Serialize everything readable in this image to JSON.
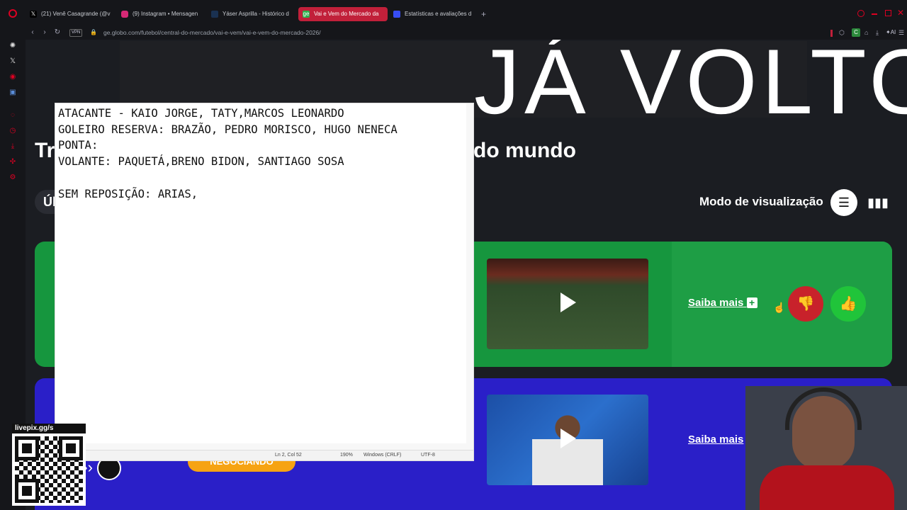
{
  "browser": {
    "tabs": [
      {
        "label": "(21) Venê Casagrande (@v",
        "icon": "x-icon"
      },
      {
        "label": "(9) Instagram • Mensagen",
        "icon": "instagram-icon"
      },
      {
        "label": "Yáser Asprilla - Histórico d",
        "icon": "transfermarkt-icon"
      },
      {
        "label": "Vai e Vem do Mercado da",
        "icon": "ge-icon"
      },
      {
        "label": "Estatísticas e avaliações d",
        "icon": "sofascore-icon"
      }
    ],
    "new_tab": "+",
    "vpn": "VPN",
    "url": "ge.globo.com/futebol/central-do-mercado/vai-e-vem/vai-e-vem-do-mercado-2026/",
    "ai_label": "AI",
    "ext_badge": "C"
  },
  "page": {
    "banner_text": "JÁ VOLTO",
    "heading_left": "Tr",
    "heading_right": "do mundo",
    "tab_left": "Úl",
    "view_mode_label": "Modo de visualização",
    "cards": [
      {
        "saiba_label": "Saiba mais",
        "plus": "+"
      },
      {
        "saiba_label": "Saiba mais"
      }
    ],
    "promo_text": "NEGOCIANDO"
  },
  "notepad": {
    "lines": [
      "ATACANTE - KAIO JORGE, TATY,MARCOS LEONARDO",
      "GOLEIRO RESERVA: BRAZÃO, PEDRO MORISCO, HUGO NENECA",
      "PONTA:",
      "VOLANTE: PAQUETÁ,BRENO BIDON, SANTIAGO SOSA",
      "",
      "SEM REPOSIÇÃO: ARIAS,"
    ],
    "status": {
      "position": "Ln 2, Col 52",
      "zoom": "190%",
      "line_ending": "Windows (CRLF)",
      "encoding": "UTF-8"
    }
  },
  "overlay": {
    "qr_label": "livepix.gg/s"
  },
  "colors": {
    "green_card": "#16963e",
    "blue_card": "#2a1fc8",
    "dislike": "#c8222b",
    "like": "#20c43a",
    "active_tab": "#c1203a"
  }
}
